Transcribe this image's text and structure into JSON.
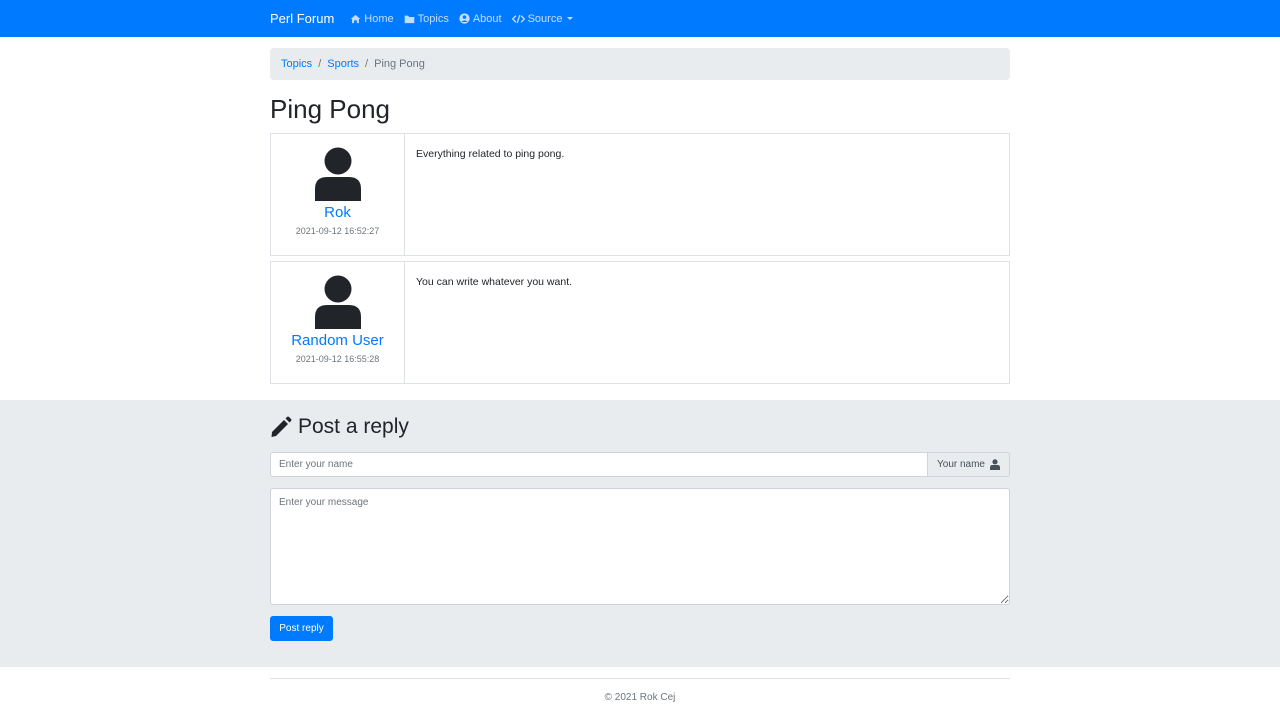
{
  "navbar": {
    "brand": "Perl Forum",
    "links": [
      {
        "label": "Home",
        "icon": "home-icon"
      },
      {
        "label": "Topics",
        "icon": "folder-icon"
      },
      {
        "label": "About",
        "icon": "user-circle-icon"
      },
      {
        "label": "Source",
        "icon": "code-icon"
      }
    ]
  },
  "breadcrumb": {
    "items": [
      "Topics",
      "Sports",
      "Ping Pong"
    ],
    "separator": "/"
  },
  "page": {
    "title": "Ping Pong"
  },
  "posts": [
    {
      "author": "Rok",
      "date": "2021-09-12 16:52:27",
      "body": "Everything related to ping pong."
    },
    {
      "author": "Random User",
      "date": "2021-09-12 16:55:28",
      "body": "You can write whatever you want."
    }
  ],
  "reply": {
    "title": "Post a reply",
    "name_placeholder": "Enter your name",
    "name_addon": "Your name",
    "message_placeholder": "Enter your message",
    "submit_label": "Post reply"
  },
  "footer": {
    "text": "© 2021 Rok Cej"
  },
  "colors": {
    "primary": "#007bff",
    "light_gray": "#e9ecef",
    "muted": "#6c757d"
  }
}
